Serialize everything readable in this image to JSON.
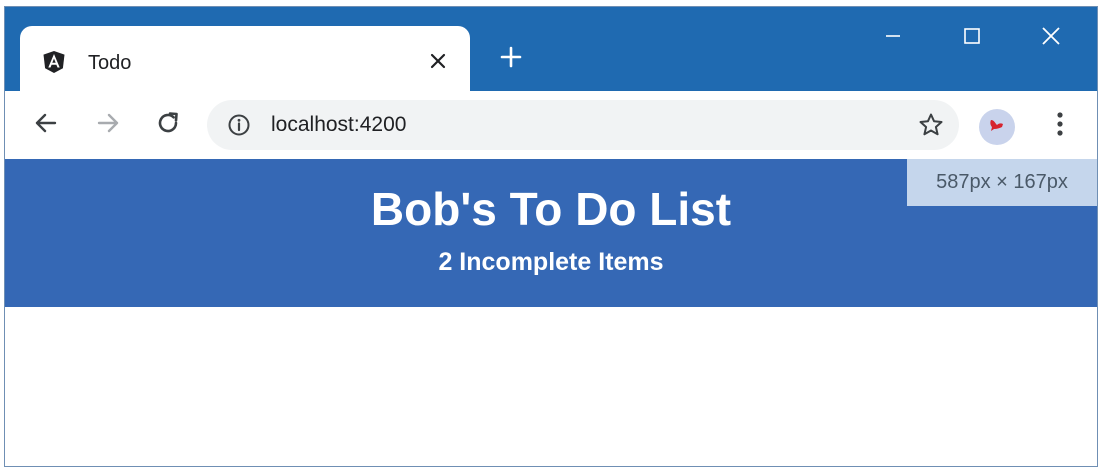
{
  "browser": {
    "tab": {
      "title": "Todo",
      "favicon": "angular-icon"
    },
    "new_tab_icon": "plus-icon",
    "window_controls": [
      "minimize-icon",
      "maximize-icon",
      "close-icon"
    ],
    "address_bar": {
      "url": "localhost:4200",
      "info_icon": "info-icon",
      "bookmark_icon": "star-icon"
    },
    "nav_icons": [
      "back-arrow-icon",
      "forward-arrow-icon",
      "reload-icon"
    ],
    "menu_icon": "kebab-menu-icon",
    "colors": {
      "titlebar": "#1f6ab1",
      "omnibox": "#f1f3f4"
    }
  },
  "page": {
    "title": "Bob's To Do List",
    "subtitle": "2 Incomplete Items",
    "header_color": "#3568b5"
  },
  "devtools": {
    "size_label": "587px × 167px"
  }
}
